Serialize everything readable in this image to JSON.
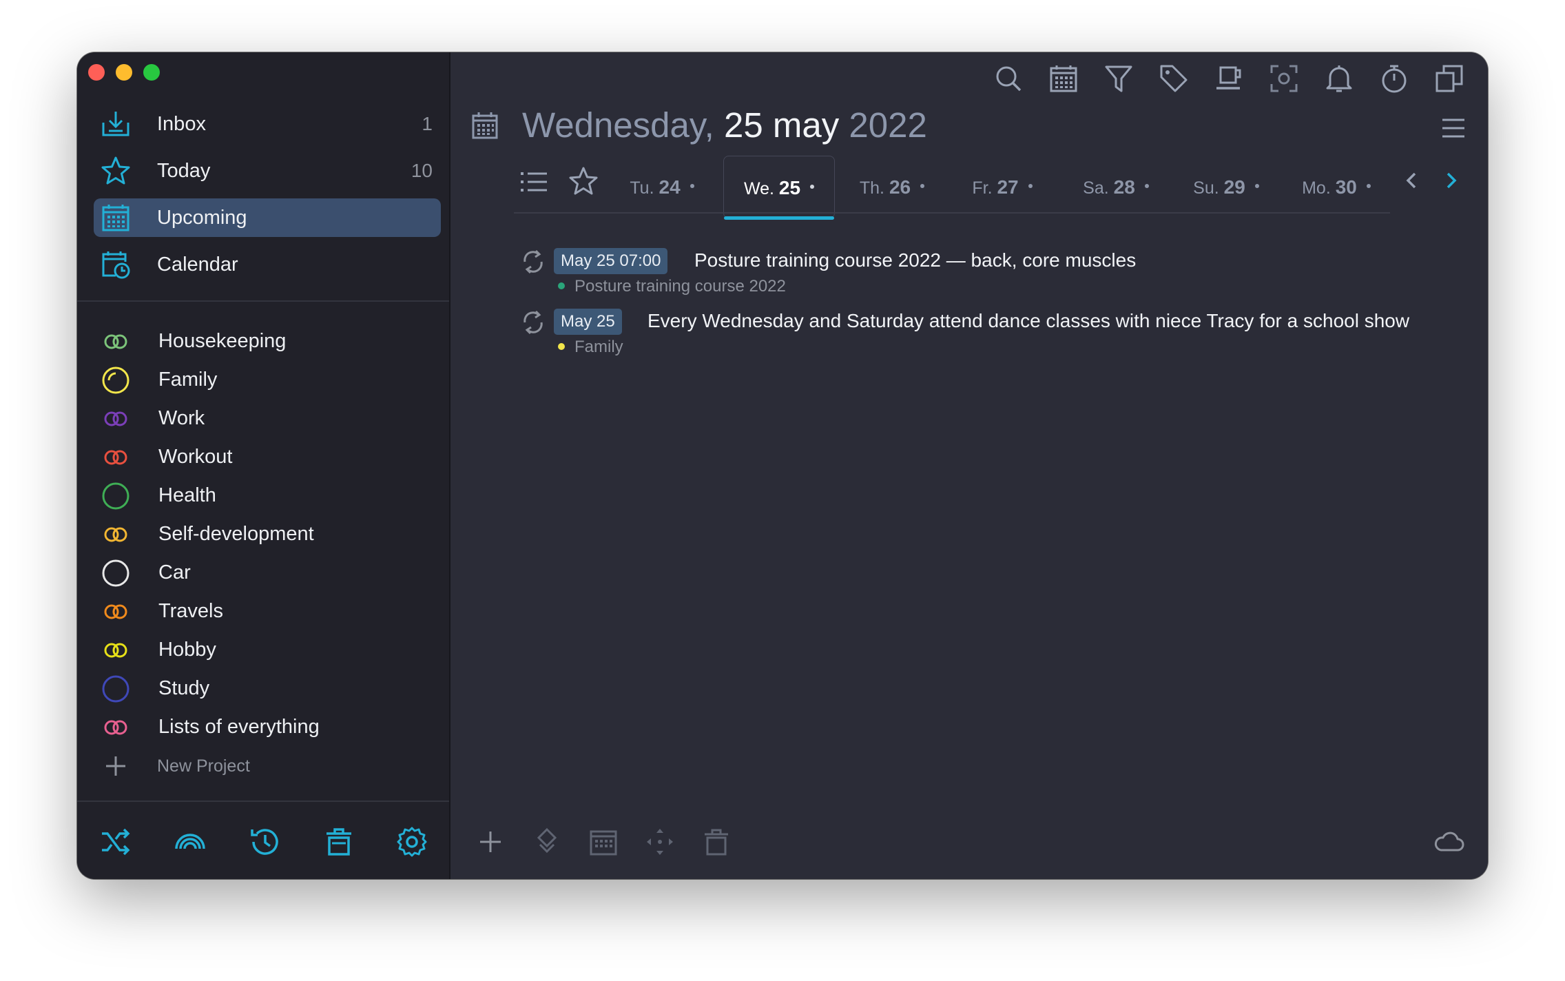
{
  "window": {
    "controls": [
      "close",
      "minimize",
      "zoom"
    ]
  },
  "sidebar": {
    "nav": [
      {
        "label": "Inbox",
        "count": "1",
        "icon": "inbox-icon"
      },
      {
        "label": "Today",
        "count": "10",
        "icon": "star-icon"
      },
      {
        "label": "Upcoming",
        "count": "",
        "icon": "calendar-grid-icon",
        "selected": true
      },
      {
        "label": "Calendar",
        "count": "",
        "icon": "calendar-clock-icon"
      }
    ],
    "projects": [
      {
        "label": "Housekeeping",
        "color": "#7cc47a",
        "icon": "double-ring-icon"
      },
      {
        "label": "Family",
        "color": "#f2e64b",
        "icon": "ring-icon"
      },
      {
        "label": "Work",
        "color": "#7b3fb8",
        "icon": "double-ring-icon"
      },
      {
        "label": "Workout",
        "color": "#e8503f",
        "icon": "double-ring-icon"
      },
      {
        "label": "Health",
        "color": "#3fae55",
        "icon": "ring-icon"
      },
      {
        "label": "Self-development",
        "color": "#f2b632",
        "icon": "double-ring-icon"
      },
      {
        "label": "Car",
        "color": "#e8e8e8",
        "icon": "ring-icon"
      },
      {
        "label": "Travels",
        "color": "#f08a1c",
        "icon": "double-ring-icon"
      },
      {
        "label": "Hobby",
        "color": "#e6e018",
        "icon": "double-ring-icon"
      },
      {
        "label": "Study",
        "color": "#3f48b8",
        "icon": "ring-icon"
      },
      {
        "label": "Lists of everything",
        "color": "#e86090",
        "icon": "double-ring-icon"
      }
    ],
    "new_project": "New Project",
    "bottom_icons": [
      "shuffle-icon",
      "rainbow-icon",
      "history-icon",
      "trash-icon",
      "settings-gear-icon"
    ]
  },
  "toolbar": {
    "icons": [
      "search-icon",
      "calendar-icon",
      "filter-icon",
      "tag-icon",
      "coffee-cup-icon",
      "focus-icon",
      "bell-icon",
      "stopwatch-icon",
      "copy-windows-icon"
    ]
  },
  "header": {
    "weekday": "Wednesday,",
    "day_month": "25 may",
    "year": "2022"
  },
  "days": [
    {
      "prefix": "Tu.",
      "num": "24",
      "active": false
    },
    {
      "prefix": "We.",
      "num": "25",
      "active": true
    },
    {
      "prefix": "Th.",
      "num": "26",
      "active": false
    },
    {
      "prefix": "Fr.",
      "num": "27",
      "active": false
    },
    {
      "prefix": "Sa.",
      "num": "28",
      "active": false
    },
    {
      "prefix": "Su.",
      "num": "29",
      "active": false
    },
    {
      "prefix": "Mo.",
      "num": "30",
      "active": false
    }
  ],
  "tasks": [
    {
      "date": "May 25 07:00",
      "title": "Posture training course 2022 — back, core muscles",
      "project": "Posture training course 2022",
      "project_color": "#2aa57a"
    },
    {
      "date": "May 25",
      "title": "Every Wednesday and Saturday attend dance classes with niece Tracy for a school show",
      "project": "Family",
      "project_color": "#f2e64b"
    }
  ],
  "footer": {
    "icons": [
      "add-icon",
      "priority-icon",
      "calendar-icon",
      "move-icon",
      "trash-icon",
      "cloud-icon"
    ]
  },
  "colors": {
    "accent": "#23b0d6",
    "selected_bg": "#3b4f6e",
    "sidebar_bg": "#212129",
    "main_bg": "#2b2c37"
  }
}
